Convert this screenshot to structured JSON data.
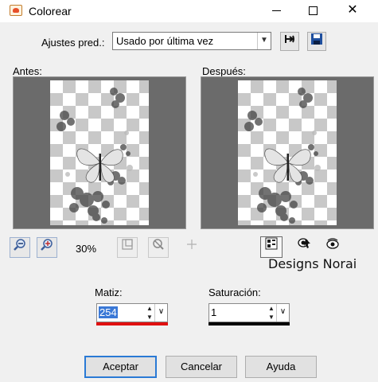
{
  "window": {
    "title": "Colorear",
    "minimize_icon": "minimize-icon",
    "maximize_icon": "maximize-icon",
    "close_glyph": "✕"
  },
  "presets": {
    "label": "Ajustes pred.:",
    "value": "Usado por última vez",
    "reset_icon": "reset-arrow-icon",
    "save_icon": "floppy-disk-icon"
  },
  "preview": {
    "before_label": "Antes:",
    "after_label": "Después:"
  },
  "zoom": {
    "level": "30%",
    "zoom_out_icon": "zoom-out-icon",
    "zoom_in_icon": "zoom-in-icon"
  },
  "signature": "Designs Norai",
  "hue": {
    "label": "Matiz:",
    "value": "254",
    "bar_color": "#e01010"
  },
  "saturation": {
    "label": "Saturación:",
    "value": "1",
    "bar_color": "#000000"
  },
  "buttons": {
    "ok": "Aceptar",
    "cancel": "Cancelar",
    "help": "Ayuda"
  },
  "colors": {
    "accent": "#2a7ad5",
    "selection": "#3a78d6"
  }
}
